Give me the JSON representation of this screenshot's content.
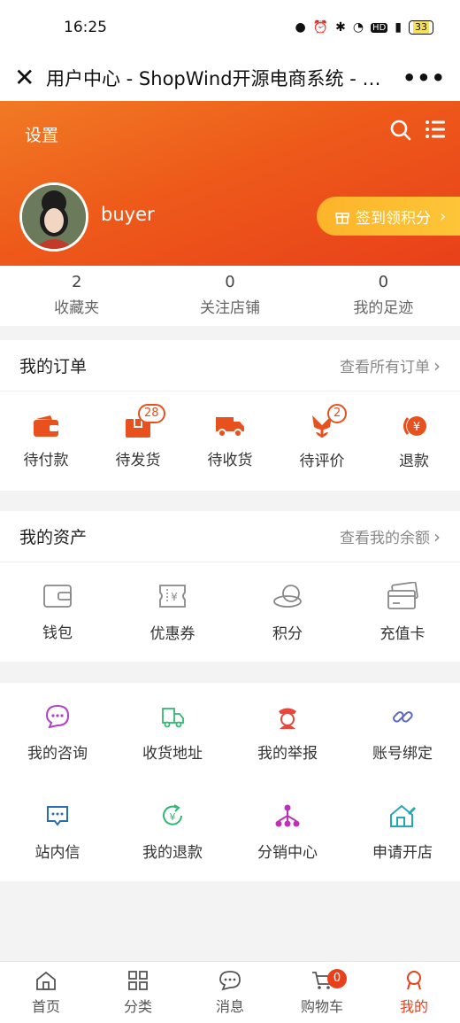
{
  "status": {
    "time": "16:25",
    "battery": "33"
  },
  "titlebar": {
    "title": "用户中心 - ShopWind开源电商系统 - 专业..."
  },
  "hero": {
    "settings_label": "设置",
    "username": "buyer",
    "checkin_label": "签到领积分"
  },
  "stats": [
    {
      "num": "2",
      "label": "收藏夹"
    },
    {
      "num": "0",
      "label": "关注店铺"
    },
    {
      "num": "0",
      "label": "我的足迹"
    }
  ],
  "orders": {
    "title": "我的订单",
    "link": "查看所有订单",
    "items": [
      {
        "label": "待付款",
        "icon": "wallet-icon"
      },
      {
        "label": "待发货",
        "icon": "package-icon",
        "badge": "28"
      },
      {
        "label": "待收货",
        "icon": "truck-icon"
      },
      {
        "label": "待评价",
        "icon": "flower-icon",
        "badge": "2"
      },
      {
        "label": "退款",
        "icon": "refund-icon"
      }
    ]
  },
  "assets": {
    "title": "我的资产",
    "link": "查看我的余额",
    "items": [
      {
        "label": "钱包",
        "icon": "wallet-outline-icon"
      },
      {
        "label": "优惠券",
        "icon": "coupon-icon"
      },
      {
        "label": "积分",
        "icon": "coins-icon"
      },
      {
        "label": "充值卡",
        "icon": "card-icon"
      }
    ]
  },
  "services": [
    {
      "label": "我的咨询",
      "icon": "chat-icon",
      "color": "#b23fc8"
    },
    {
      "label": "收货地址",
      "icon": "delivery-icon",
      "color": "#2fb872"
    },
    {
      "label": "我的举报",
      "icon": "police-icon",
      "color": "#e8453c"
    },
    {
      "label": "账号绑定",
      "icon": "link-icon",
      "color": "#5867c8"
    },
    {
      "label": "站内信",
      "icon": "message-icon",
      "color": "#2a6db5"
    },
    {
      "label": "我的退款",
      "icon": "refund-circle-icon",
      "color": "#2fb872"
    },
    {
      "label": "分销中心",
      "icon": "network-icon",
      "color": "#c02fb8"
    },
    {
      "label": "申请开店",
      "icon": "shop-icon",
      "color": "#26a7b8"
    }
  ],
  "tabbar": [
    {
      "label": "首页",
      "icon": "home-icon"
    },
    {
      "label": "分类",
      "icon": "category-icon"
    },
    {
      "label": "消息",
      "icon": "message-bubble-icon"
    },
    {
      "label": "购物车",
      "icon": "cart-icon",
      "badge": "0"
    },
    {
      "label": "我的",
      "icon": "user-icon",
      "active": true
    }
  ],
  "colors": {
    "accent": "#e8401a",
    "orange": "#ee5a1a",
    "checkin": "#fdb42b"
  }
}
